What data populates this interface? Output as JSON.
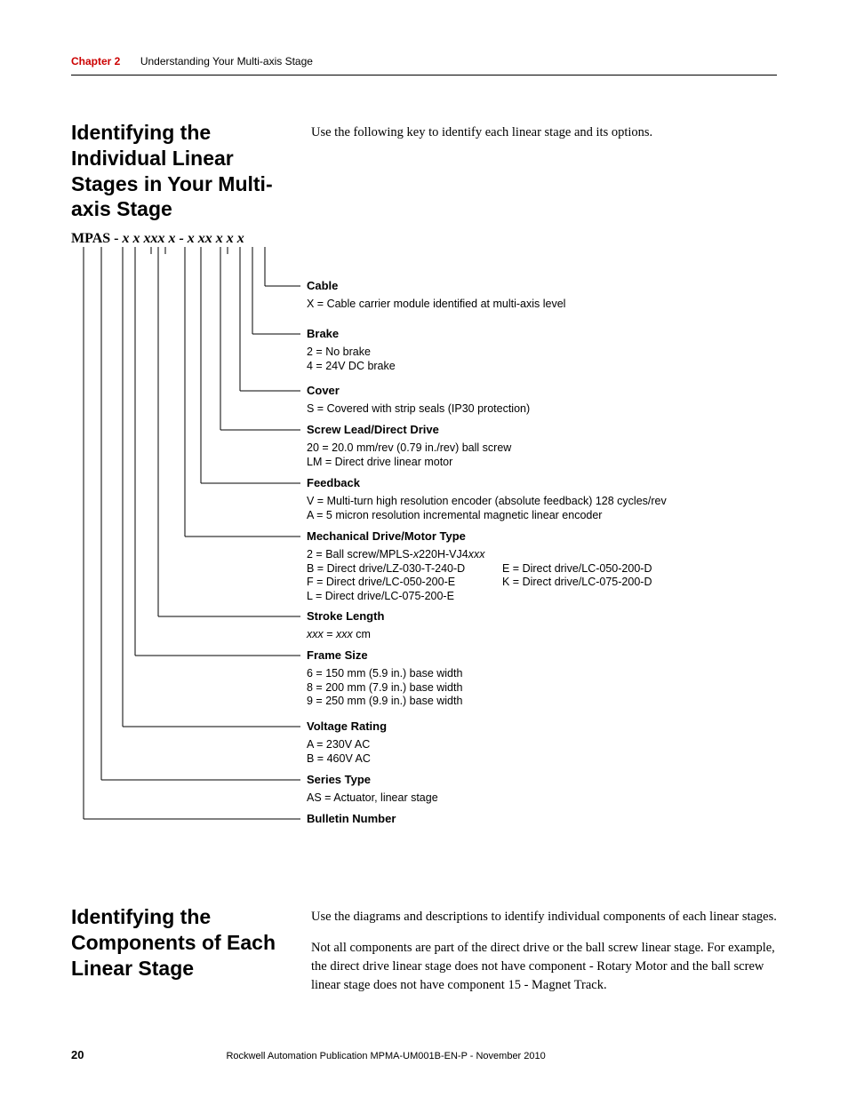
{
  "header": {
    "chapter_label": "Chapter 2",
    "chapter_title": "Understanding Your Multi-axis Stage"
  },
  "section1": {
    "heading": "Identifying the Individual Linear Stages in Your Multi-axis Stage",
    "intro": "Use the following key to identify each linear stage and its options.",
    "catalog_prefix": "MPAS -",
    "catalog_pattern": " x x xxx x - x xx x x x"
  },
  "key": {
    "cable": {
      "title": "Cable",
      "line1": "X = Cable carrier module identified at multi-axis level"
    },
    "brake": {
      "title": "Brake",
      "line1": "2 = No brake",
      "line2": "4 = 24V DC brake"
    },
    "cover": {
      "title": "Cover",
      "line1": "S = Covered with strip seals (IP30 protection)"
    },
    "screw": {
      "title": "Screw Lead/Direct Drive",
      "line1": "20 = 20.0 mm/rev (0.79 in./rev) ball screw",
      "line2": "LM = Direct drive linear motor"
    },
    "feedback": {
      "title": "Feedback",
      "line1": "V = Multi-turn high resolution encoder (absolute feedback) 128 cycles/rev",
      "line2": "A = 5 micron resolution incremental magnetic linear encoder"
    },
    "mech": {
      "title": "Mechanical Drive/Motor Type",
      "l1a": "2 = Ball screw/MPLS-",
      "l1b": "x",
      "l1c": "220H-VJ4",
      "l1d": "xxx",
      "l2": "B = Direct drive/LZ-030-T-240-D",
      "l2r": "E = Direct drive/LC-050-200-D",
      "l3": "F = Direct drive/LC-050-200-E",
      "l3r": "K = Direct drive/LC-075-200-D",
      "l4": "L = Direct drive/LC-075-200-E"
    },
    "stroke": {
      "title": "Stroke Length",
      "l1a": "xxx",
      "l1b": " = ",
      "l1c": "xxx",
      "l1d": " cm"
    },
    "frame": {
      "title": "Frame Size",
      "line1": "6 = 150 mm (5.9 in.) base width",
      "line2": "8 = 200 mm (7.9 in.) base width",
      "line3": "9 = 250 mm (9.9 in.) base width"
    },
    "voltage": {
      "title": "Voltage Rating",
      "line1": "A = 230V AC",
      "line2": "B = 460V AC"
    },
    "series": {
      "title": "Series Type",
      "line1": "AS = Actuator, linear stage"
    },
    "bulletin": {
      "title": "Bulletin Number"
    }
  },
  "section2": {
    "heading": "Identifying the Components of Each Linear Stage",
    "p1": "Use the diagrams and descriptions to identify individual components of each linear stages.",
    "p2": "Not all components are part of the direct drive or the ball screw linear stage. For example, the direct drive linear stage does not have component  - Rotary Motor and the ball screw linear stage does not have component 15 - Magnet Track."
  },
  "footer": {
    "page": "20",
    "publication": "Rockwell Automation Publication MPMA-UM001B-EN-P - November 2010"
  }
}
